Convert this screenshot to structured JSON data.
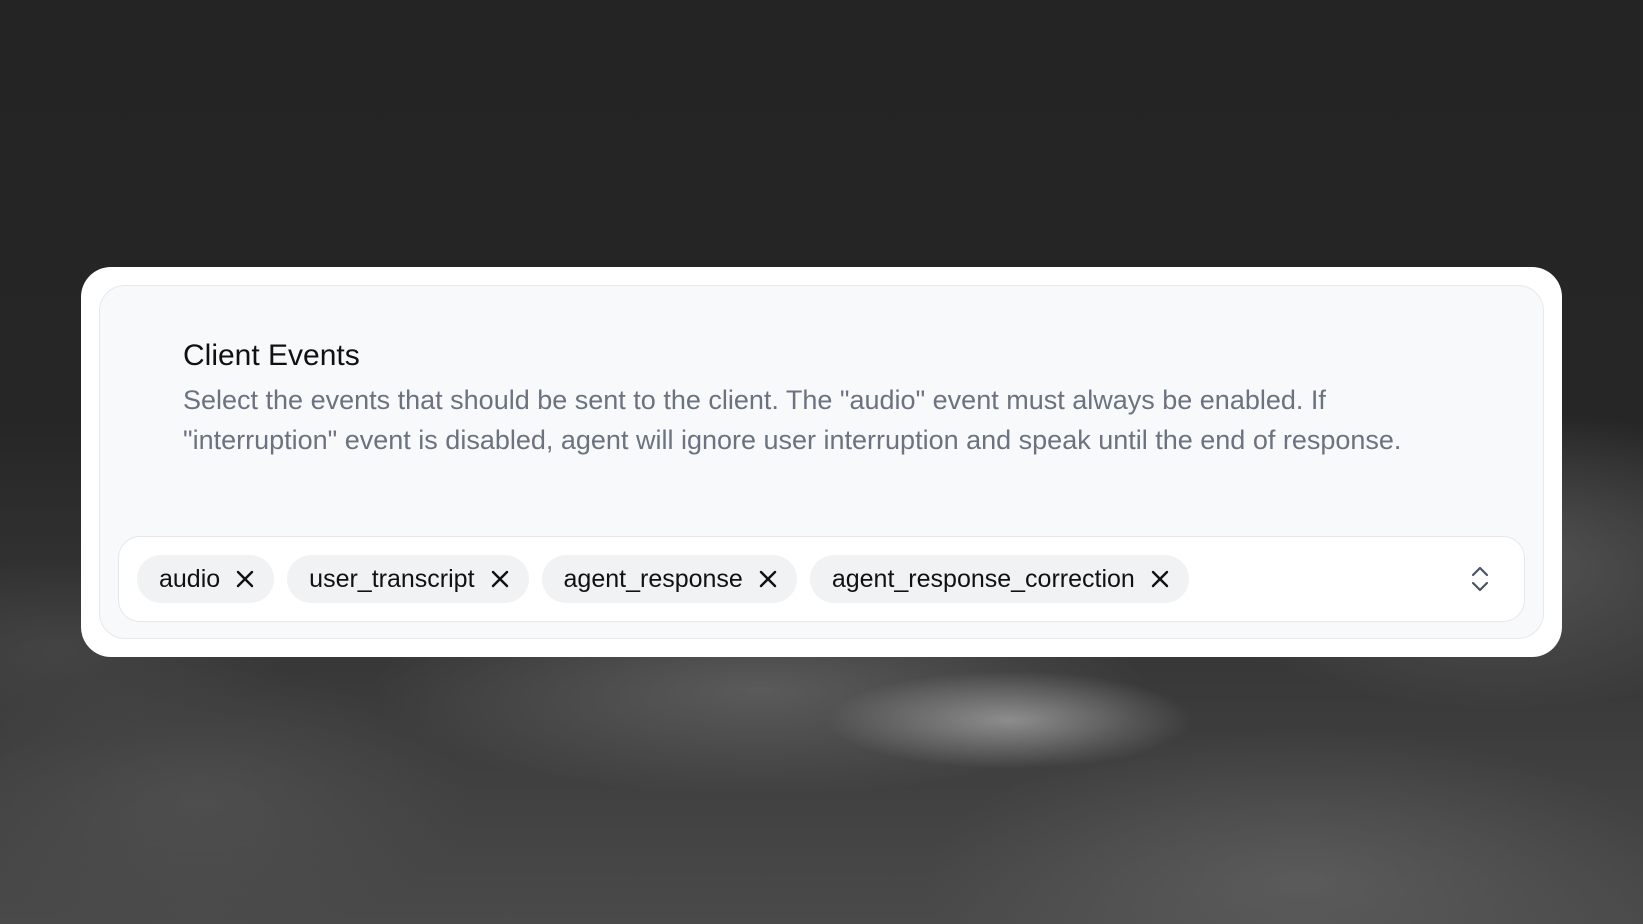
{
  "section": {
    "title": "Client Events",
    "description": "Select the events that should be sent to the client. The \"audio\" event must always be enabled. If \"interruption\" event is disabled, agent will ignore user interruption and speak until the end of response."
  },
  "select": {
    "tags": [
      {
        "label": "audio"
      },
      {
        "label": "user_transcript"
      },
      {
        "label": "agent_response"
      },
      {
        "label": "agent_response_correction"
      }
    ],
    "remove_icon": "close-icon",
    "toggle_icon": "chevron-up-down-icon"
  },
  "colors": {
    "page_bg": "#262626",
    "card_bg": "#ffffff",
    "panel_bg": "#f8f9fb",
    "tag_bg": "#f1f2f4",
    "title_text": "#111111",
    "description_text": "#6b7280"
  }
}
